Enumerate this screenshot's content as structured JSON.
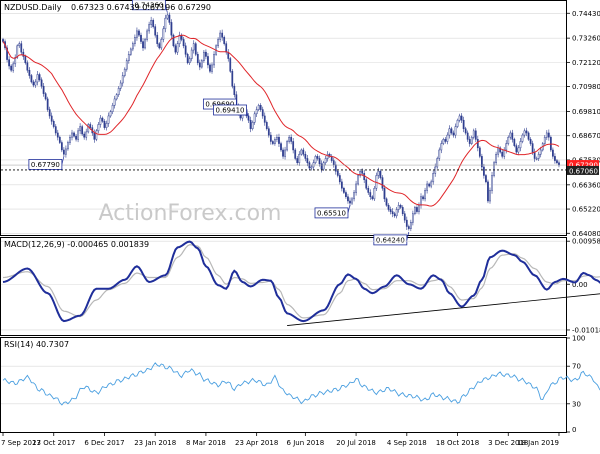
{
  "header": {
    "symbol": "NZDUSD.Daily",
    "ohlc": "0.67323 0.67439 0.67196 0.67290"
  },
  "watermark": "ActionForex.com",
  "colors": {
    "candles": "#2f3e8f",
    "ma": "#e0262a",
    "macd_line": "#1f2e9a",
    "macd_signal": "#b8b8b8",
    "rsi": "#4a9fe0",
    "grid": "#d8d8d8",
    "label_border": "#1f2e9a",
    "last_price_bg": "#ff2020",
    "current_bg": "#222222"
  },
  "chart_data": [
    {
      "type": "candlestick",
      "panel": "price",
      "title": "NZDUSD.Daily",
      "ylim": [
        0.64,
        0.7496
      ],
      "y_ticks": [
        "0.74430",
        "0.73260",
        "0.72120",
        "0.70980",
        "0.69810",
        "0.68670",
        "0.67530",
        "0.66360",
        "0.65220",
        "0.64080"
      ],
      "x_ticks": [
        "7 Sep 2017",
        "23 Oct 2017",
        "6 Dec 2017",
        "23 Jan 2018",
        "8 Mar 2018",
        "23 Apr 2018",
        "6 Jun 2018",
        "20 Jul 2018",
        "4 Sep 2018",
        "18 Oct 2018",
        "3 Dec 2018",
        "18 Jan 2019"
      ],
      "pivots": [
        {
          "label": "0.74360",
          "value": 0.7436,
          "placement": "above"
        },
        {
          "label": "0.67790",
          "value": 0.6779,
          "placement": "below"
        },
        {
          "label": "0.69690",
          "value": 0.6969,
          "placement": "above"
        },
        {
          "label": "0.69410",
          "value": 0.6941,
          "placement": "above"
        },
        {
          "label": "0.65510",
          "value": 0.6551,
          "placement": "below"
        },
        {
          "label": "0.64240",
          "value": 0.6424,
          "placement": "below"
        }
      ],
      "current_level": {
        "label": "0.67060",
        "value": 0.6706,
        "line": "dotted"
      },
      "last_price": {
        "label": "0.67290",
        "value": 0.6729
      },
      "close_series": [
        0.731,
        0.728,
        0.7225,
        0.7195,
        0.7175,
        0.7205,
        0.7235,
        0.729,
        0.73,
        0.726,
        0.724,
        0.721,
        0.7175,
        0.715,
        0.712,
        0.7105,
        0.712,
        0.7155,
        0.713,
        0.71,
        0.7065,
        0.704,
        0.699,
        0.696,
        0.6935,
        0.691,
        0.688,
        0.686,
        0.6835,
        0.68,
        0.678,
        0.6805,
        0.6835,
        0.686,
        0.688,
        0.6865,
        0.685,
        0.689,
        0.691,
        0.6875,
        0.686,
        0.6885,
        0.692,
        0.6905,
        0.688,
        0.685,
        0.689,
        0.692,
        0.695,
        0.6935,
        0.6905,
        0.6925,
        0.696,
        0.698,
        0.701,
        0.704,
        0.706,
        0.709,
        0.7115,
        0.715,
        0.718,
        0.722,
        0.725,
        0.7275,
        0.73,
        0.733,
        0.736,
        0.734,
        0.731,
        0.728,
        0.732,
        0.736,
        0.739,
        0.741,
        0.738,
        0.734,
        0.73,
        0.728,
        0.732,
        0.737,
        0.742,
        0.7435,
        0.74,
        0.734,
        0.729,
        0.726,
        0.73,
        0.734,
        0.732,
        0.729,
        0.725,
        0.721,
        0.723,
        0.727,
        0.73,
        0.725,
        0.721,
        0.719,
        0.722,
        0.726,
        0.724,
        0.72,
        0.717,
        0.72,
        0.725,
        0.729,
        0.732,
        0.735,
        0.733,
        0.73,
        0.726,
        0.723,
        0.717,
        0.71,
        0.706,
        0.701,
        0.697,
        0.695,
        0.697,
        0.699,
        0.696,
        0.694,
        0.69,
        0.693,
        0.697,
        0.699,
        0.701,
        0.699,
        0.696,
        0.693,
        0.69,
        0.687,
        0.684,
        0.683,
        0.685,
        0.686,
        0.683,
        0.68,
        0.677,
        0.68,
        0.684,
        0.686,
        0.684,
        0.68,
        0.676,
        0.674,
        0.678,
        0.68,
        0.678,
        0.676,
        0.674,
        0.6715,
        0.672,
        0.674,
        0.677,
        0.676,
        0.6735,
        0.671,
        0.674,
        0.676,
        0.678,
        0.677,
        0.675,
        0.673,
        0.67,
        0.668,
        0.665,
        0.662,
        0.66,
        0.658,
        0.656,
        0.655,
        0.657,
        0.66,
        0.664,
        0.668,
        0.67,
        0.669,
        0.666,
        0.662,
        0.66,
        0.658,
        0.657,
        0.662,
        0.668,
        0.67,
        0.667,
        0.662,
        0.657,
        0.654,
        0.652,
        0.651,
        0.65,
        0.649,
        0.652,
        0.654,
        0.653,
        0.65,
        0.647,
        0.644,
        0.643,
        0.646,
        0.65,
        0.653,
        0.651,
        0.654,
        0.658,
        0.657,
        0.661,
        0.664,
        0.663,
        0.665,
        0.669,
        0.672,
        0.676,
        0.68,
        0.683,
        0.685,
        0.684,
        0.687,
        0.69,
        0.688,
        0.687,
        0.691,
        0.694,
        0.696,
        0.694,
        0.69,
        0.688,
        0.685,
        0.683,
        0.686,
        0.689,
        0.685,
        0.681,
        0.677,
        0.672,
        0.668,
        0.665,
        0.656,
        0.661,
        0.668,
        0.674,
        0.678,
        0.681,
        0.679,
        0.677,
        0.68,
        0.683,
        0.686,
        0.688,
        0.685,
        0.682,
        0.679,
        0.681,
        0.684,
        0.687,
        0.689,
        0.688,
        0.685,
        0.683,
        0.679,
        0.676,
        0.676,
        0.678,
        0.68,
        0.683,
        0.686,
        0.688,
        0.686,
        0.68,
        0.677,
        0.675,
        0.674,
        0.6729
      ]
    },
    {
      "type": "line",
      "panel": "macd",
      "title": "MACD(12,26,9) -0.000465 0.001839",
      "ylim": [
        -0.0113,
        0.0103
      ],
      "y_ticks": [
        "0.009587",
        "0.00",
        "-0.01018"
      ],
      "series": [
        {
          "name": "MACD",
          "anchors": [
            [
              0,
              0.0005
            ],
            [
              12,
              0.0035
            ],
            [
              22,
              -0.002
            ],
            [
              30,
              -0.0082
            ],
            [
              38,
              -0.007
            ],
            [
              46,
              -0.001
            ],
            [
              52,
              -0.001
            ],
            [
              60,
              0.001
            ],
            [
              66,
              0.004
            ],
            [
              72,
              0.0005
            ],
            [
              80,
              0.002
            ],
            [
              86,
              0.0082
            ],
            [
              92,
              0.0095
            ],
            [
              96,
              0.008
            ],
            [
              100,
              0.004
            ],
            [
              106,
              -0.0002
            ],
            [
              110,
              -0.001
            ],
            [
              114,
              0.003
            ],
            [
              118,
              0.0005
            ],
            [
              122,
              -0.0005
            ],
            [
              128,
              0.001
            ],
            [
              132,
              0.0008
            ],
            [
              136,
              -0.003
            ],
            [
              140,
              -0.0065
            ],
            [
              148,
              -0.0082
            ],
            [
              158,
              -0.0058
            ],
            [
              166,
              0.0
            ],
            [
              170,
              0.0022
            ],
            [
              174,
              0.0012
            ],
            [
              178,
              -0.001
            ],
            [
              182,
              -0.002
            ],
            [
              188,
              -0.0005
            ],
            [
              194,
              0.002
            ],
            [
              200,
              0.0
            ],
            [
              206,
              -0.001
            ],
            [
              212,
              0.002
            ],
            [
              216,
              0.001
            ],
            [
              220,
              -0.002
            ],
            [
              226,
              -0.005
            ],
            [
              232,
              -0.0025
            ],
            [
              236,
              0.001
            ],
            [
              240,
              0.006
            ],
            [
              246,
              0.0075
            ],
            [
              252,
              0.0065
            ],
            [
              256,
              0.005
            ],
            [
              262,
              0.002
            ],
            [
              268,
              -0.0012
            ],
            [
              272,
              0.0005
            ],
            [
              276,
              0.0012
            ],
            [
              282,
              0.0004
            ],
            [
              286,
              0.0025
            ],
            [
              289,
              0.002
            ],
            [
              292,
              0.001
            ],
            [
              297,
              -0.0005
            ]
          ]
        },
        {
          "name": "Signal",
          "anchors": [
            [
              0,
              0.0015
            ],
            [
              12,
              0.0028
            ],
            [
              22,
              -0.0005
            ],
            [
              30,
              -0.006
            ],
            [
              38,
              -0.0072
            ],
            [
              46,
              -0.0035
            ],
            [
              52,
              -0.0012
            ],
            [
              60,
              0.0002
            ],
            [
              66,
              0.0025
            ],
            [
              72,
              0.0015
            ],
            [
              80,
              0.0015
            ],
            [
              86,
              0.006
            ],
            [
              92,
              0.0088
            ],
            [
              96,
              0.0085
            ],
            [
              100,
              0.006
            ],
            [
              106,
              0.002
            ],
            [
              110,
              0.0
            ],
            [
              114,
              0.0015
            ],
            [
              118,
              0.0012
            ],
            [
              122,
              0.0002
            ],
            [
              128,
              0.0004
            ],
            [
              132,
              0.0007
            ],
            [
              136,
              -0.0012
            ],
            [
              140,
              -0.0045
            ],
            [
              148,
              -0.0075
            ],
            [
              158,
              -0.0068
            ],
            [
              166,
              -0.002
            ],
            [
              170,
              0.0008
            ],
            [
              174,
              0.0012
            ],
            [
              178,
              0.0002
            ],
            [
              182,
              -0.0012
            ],
            [
              188,
              -0.001
            ],
            [
              194,
              0.0008
            ],
            [
              200,
              0.0008
            ],
            [
              206,
              -0.0002
            ],
            [
              212,
              0.0008
            ],
            [
              216,
              0.0012
            ],
            [
              220,
              -0.0005
            ],
            [
              226,
              -0.0035
            ],
            [
              232,
              -0.0032
            ],
            [
              236,
              -0.0008
            ],
            [
              240,
              0.0035
            ],
            [
              246,
              0.0065
            ],
            [
              252,
              0.0068
            ],
            [
              256,
              0.0058
            ],
            [
              262,
              0.0035
            ],
            [
              268,
              0.0005
            ],
            [
              272,
              0.0
            ],
            [
              276,
              0.0008
            ],
            [
              282,
              0.0008
            ],
            [
              286,
              0.0018
            ],
            [
              289,
              0.002
            ],
            [
              292,
              0.0016
            ],
            [
              297,
              0.0018
            ]
          ]
        }
      ],
      "trendline": [
        [
          140,
          -0.0092
        ],
        [
          297,
          -0.002
        ]
      ]
    },
    {
      "type": "line",
      "panel": "rsi",
      "title": "RSI(14) 40.7307",
      "ylim": [
        0,
        100
      ],
      "y_ticks": [
        "100",
        "70",
        "30",
        "0"
      ],
      "levels": [
        70,
        30
      ],
      "series": [
        {
          "name": "RSI",
          "anchors": [
            [
              0,
              55
            ],
            [
              6,
              52
            ],
            [
              12,
              58
            ],
            [
              18,
              45
            ],
            [
              24,
              38
            ],
            [
              30,
              30
            ],
            [
              34,
              34
            ],
            [
              40,
              48
            ],
            [
              46,
              42
            ],
            [
              52,
              50
            ],
            [
              58,
              55
            ],
            [
              64,
              60
            ],
            [
              70,
              65
            ],
            [
              76,
              72
            ],
            [
              82,
              68
            ],
            [
              88,
              60
            ],
            [
              92,
              66
            ],
            [
              96,
              62
            ],
            [
              100,
              55
            ],
            [
              106,
              50
            ],
            [
              110,
              54
            ],
            [
              114,
              46
            ],
            [
              118,
              52
            ],
            [
              124,
              55
            ],
            [
              130,
              50
            ],
            [
              134,
              58
            ],
            [
              138,
              44
            ],
            [
              142,
              38
            ],
            [
              148,
              32
            ],
            [
              152,
              38
            ],
            [
              158,
              42
            ],
            [
              164,
              45
            ],
            [
              170,
              50
            ],
            [
              174,
              56
            ],
            [
              178,
              48
            ],
            [
              184,
              42
            ],
            [
              190,
              46
            ],
            [
              196,
              40
            ],
            [
              202,
              38
            ],
            [
              208,
              34
            ],
            [
              212,
              40
            ],
            [
              218,
              36
            ],
            [
              224,
              32
            ],
            [
              228,
              40
            ],
            [
              232,
              48
            ],
            [
              236,
              55
            ],
            [
              240,
              58
            ],
            [
              244,
              62
            ],
            [
              250,
              60
            ],
            [
              256,
              55
            ],
            [
              262,
              48
            ],
            [
              266,
              35
            ],
            [
              270,
              50
            ],
            [
              276,
              58
            ],
            [
              282,
              55
            ],
            [
              286,
              63
            ],
            [
              290,
              58
            ],
            [
              294,
              46
            ],
            [
              297,
              40.7
            ]
          ]
        }
      ]
    }
  ]
}
